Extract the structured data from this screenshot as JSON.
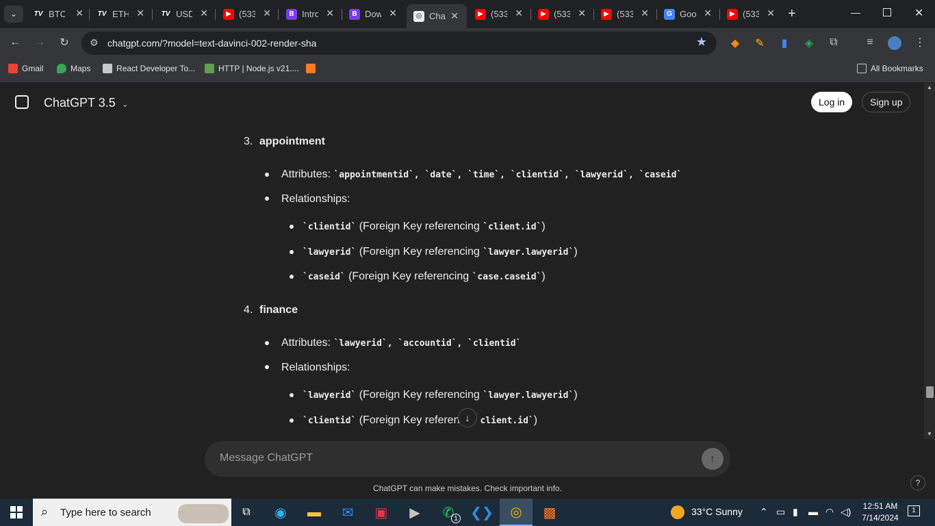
{
  "browser": {
    "tabs": [
      {
        "title": "BTCU",
        "favicon": "tradingview-icon"
      },
      {
        "title": "ETH",
        "favicon": "tradingview-icon"
      },
      {
        "title": "USD",
        "favicon": "tradingview-icon"
      },
      {
        "title": "(533",
        "favicon": "youtube-icon"
      },
      {
        "title": "Intro",
        "favicon": "bootstrap-icon"
      },
      {
        "title": "Dow",
        "favicon": "bootstrap-icon"
      },
      {
        "title": "Cha",
        "favicon": "chatgpt-icon"
      },
      {
        "title": "(533",
        "favicon": "youtube-icon"
      },
      {
        "title": "(533",
        "favicon": "youtube-icon"
      },
      {
        "title": "(533",
        "favicon": "youtube-icon"
      },
      {
        "title": "Goo",
        "favicon": "google-translate-icon"
      },
      {
        "title": "(533",
        "favicon": "youtube-icon"
      }
    ],
    "url": "chatgpt.com/?model=text-davinci-002-render-sha",
    "bookmarks": [
      {
        "label": "Gmail"
      },
      {
        "label": "Maps"
      },
      {
        "label": "React Developer To..."
      },
      {
        "label": "HTTP | Node.js v21...."
      }
    ],
    "all_bookmarks": "All Bookmarks"
  },
  "chat": {
    "model_label": "ChatGPT 3.5",
    "login": "Log in",
    "signup": "Sign up",
    "sections": [
      {
        "num": "3.",
        "title": "appointment",
        "attributes_label": "Attributes:",
        "attributes": "`appointmentid`, `date`, `time`, `clientid`, `lawyerid`, `caseid`",
        "relationships_label": "Relationships:",
        "relationships": [
          {
            "code": "`clientid`",
            "text": " (Foreign Key referencing ",
            "ref": "`client.id`",
            "close": ")"
          },
          {
            "code": "`lawyerid`",
            "text": " (Foreign Key referencing ",
            "ref": "`lawyer.lawyerid`",
            "close": ")"
          },
          {
            "code": "`caseid`",
            "text": " (Foreign Key referencing ",
            "ref": "`case.caseid`",
            "close": ")"
          }
        ]
      },
      {
        "num": "4.",
        "title": "finance",
        "attributes_label": "Attributes:",
        "attributes": "`lawyerid`, `accountid`, `clientid`",
        "relationships_label": "Relationships:",
        "relationships": [
          {
            "code": "`lawyerid`",
            "text": " (Foreign Key referencing ",
            "ref": "`lawyer.lawyerid`",
            "close": ")"
          },
          {
            "code": "`clientid`",
            "text": " (Foreign Key referenc",
            "ref": "client.id`",
            "close": ")"
          }
        ]
      }
    ],
    "message_placeholder": "Message ChatGPT",
    "disclaimer": "ChatGPT can make mistakes. Check important info."
  },
  "taskbar": {
    "search_placeholder": "Type here to search",
    "weather": "33°C  Sunny",
    "time": "12:51 AM",
    "date": "7/14/2024",
    "notification_count": "1",
    "whatsapp_badge": "1"
  },
  "colors": {
    "page_bg": "#212121",
    "tab_bg": "#202124",
    "toolbar_bg": "#35363a",
    "taskbar_bg": "#1c2b3a"
  }
}
